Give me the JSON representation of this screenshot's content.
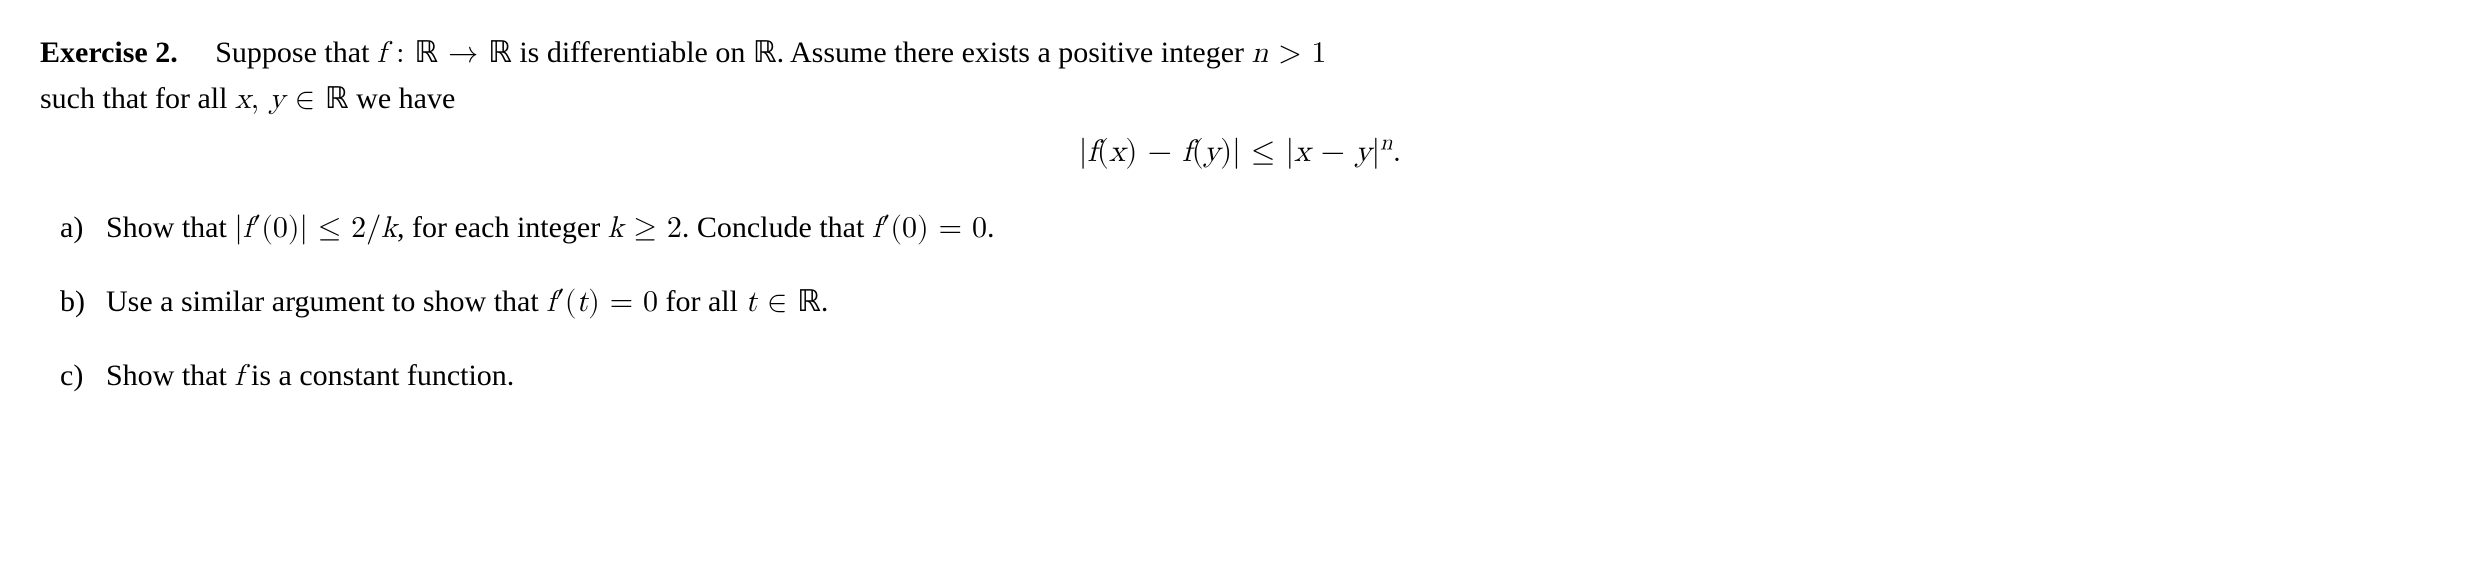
{
  "exercise": {
    "label": "Exercise 2.",
    "intro_prefix": "Suppose that ",
    "fn_decl": "f : ℝ → ℝ",
    "intro_mid1": " is differentiable on ",
    "reals1": "ℝ",
    "intro_mid2": ". Assume there exists a positive integer ",
    "n_cond": "n > 1",
    "intro_mid3": " such that for all ",
    "xy_in": "x, y ∈ ℝ",
    "intro_tail": " we have",
    "display": "|f(x) − f(y)| ≤ |x − y|",
    "display_exp": "n",
    "display_period": "."
  },
  "parts": [
    {
      "label": "a)",
      "text1": "Show that ",
      "math1": "|f′(0)| ≤ 2/k",
      "text2": ", for each integer ",
      "math2": "k ≥ 2",
      "text3": ". Conclude that ",
      "math3": "f′(0) = 0",
      "text4": "."
    },
    {
      "label": "b)",
      "text1": "Use a similar argument to show that ",
      "math1": "f′(t) = 0",
      "text2": " for all ",
      "math2": "t ∈ ℝ",
      "text3": "."
    },
    {
      "label": "c)",
      "text1": "Show that ",
      "math1": "f",
      "text2": " is a constant function."
    }
  ]
}
